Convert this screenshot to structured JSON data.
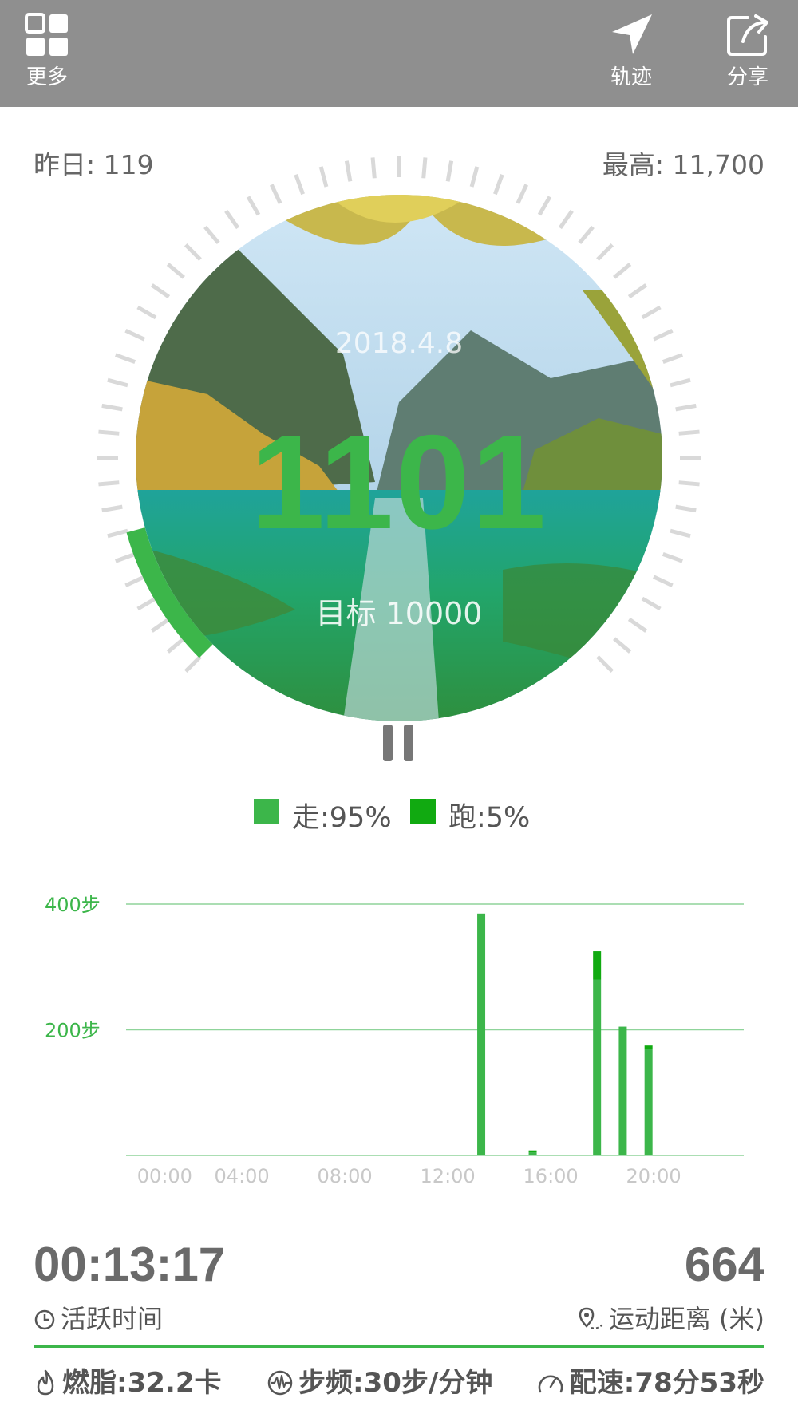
{
  "header": {
    "more_label": "更多",
    "track_label": "轨迹",
    "share_label": "分享"
  },
  "stats": {
    "yesterday": "昨日: 119",
    "best": "最高: 11,700"
  },
  "dial": {
    "date": "2018.4.8",
    "steps": "1101",
    "goal": "目标 10000",
    "progress_fraction": 0.11
  },
  "legend": {
    "walk": "走:95%",
    "run": "跑:5%"
  },
  "colors": {
    "accent": "#3cb64a",
    "run": "#11aa11",
    "topbar": "#8f8f8f"
  },
  "chart_data": {
    "type": "bar",
    "ylabel_ticks": [
      "200步",
      "400步"
    ],
    "y_ticks": [
      200,
      400
    ],
    "ylim": [
      0,
      400
    ],
    "x_tick_labels": [
      "00:00",
      "04:00",
      "08:00",
      "12:00",
      "16:00",
      "20:00"
    ],
    "x_ticks": [
      0,
      3,
      7,
      11,
      15,
      19
    ],
    "xlim": [
      -1.5,
      22.5
    ],
    "grid": true,
    "series": [
      {
        "x": [
          12.3,
          14.3,
          16.8,
          17.8,
          18.8
        ],
        "walk": [
          385,
          5,
          280,
          205,
          170
        ],
        "run": [
          0,
          3,
          45,
          0,
          5
        ]
      }
    ]
  },
  "summary": {
    "active_time": "00:13:17",
    "active_label": "活跃时间",
    "distance": "664",
    "distance_label": "运动距离 (米)",
    "fat": "燃脂:32.2卡",
    "cadence": "步频:30步/分钟",
    "pace": "配速:78分53秒"
  }
}
